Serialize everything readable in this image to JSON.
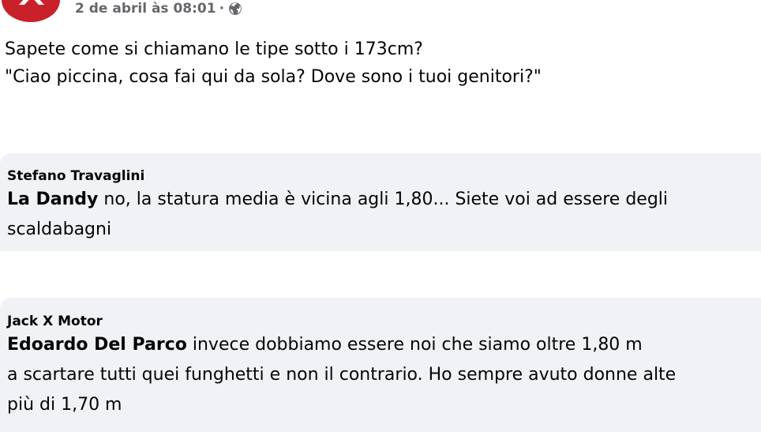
{
  "post": {
    "avatar_icon": "page-logo-icon",
    "avatar_color": "#c9212a",
    "timestamp": "2 de abril às 08:01",
    "separator": "·",
    "privacy_icon": "globe-icon",
    "text_lines": [
      "Sapete come si chiamano le tipe sotto i 173cm?",
      "\"Ciao piccina, cosa fai qui da sola? Dove sono i tuoi genitori?\""
    ]
  },
  "comments": [
    {
      "author": "Stefano Travaglini",
      "mention": "La Dandy",
      "line1_rest": " no, la statura media è vicina agli 1,80... Siete voi ad essere degli",
      "line2": "scaldabagni"
    },
    {
      "author": "Jack X Motor",
      "mention": "Edoardo Del Parco",
      "line1_rest": " invece dobbiamo essere noi che siamo oltre 1,80 m",
      "line2": "a scartare tutti quei funghetti e non il contrario. Ho sempre avuto donne alte",
      "line3": "più di 1,70 m"
    }
  ]
}
